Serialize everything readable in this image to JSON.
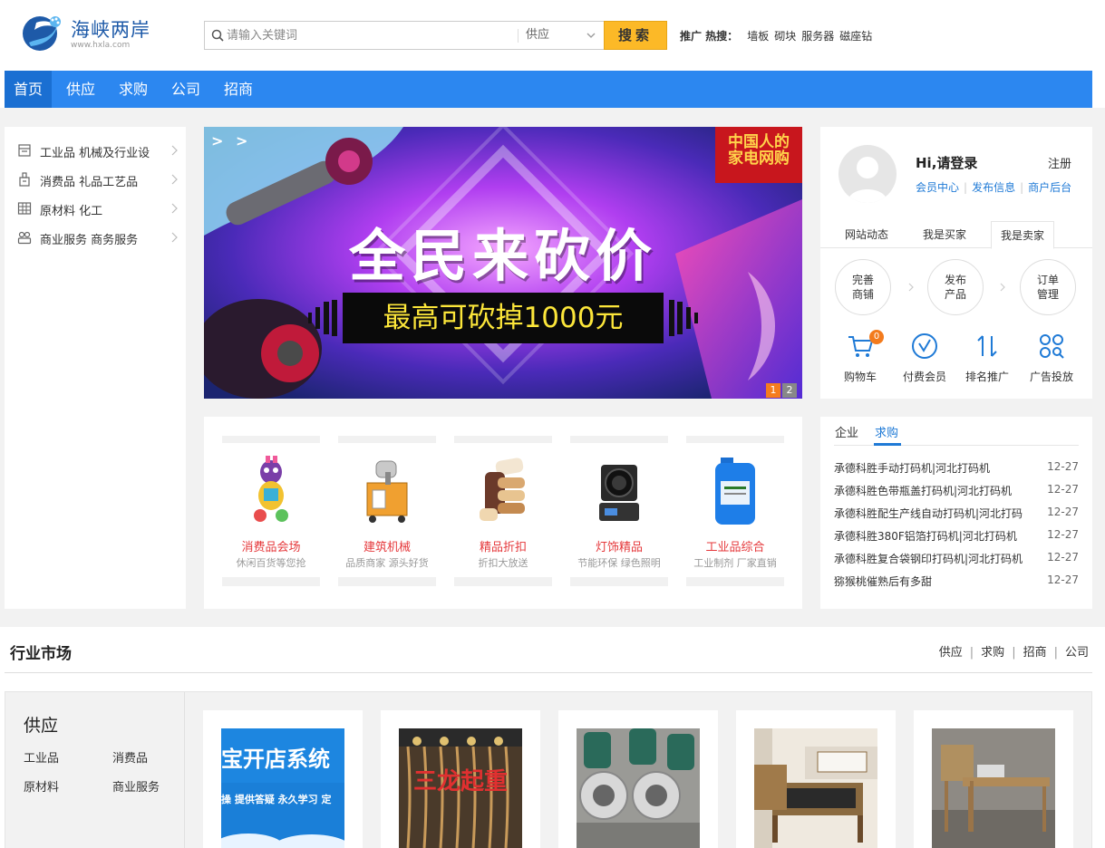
{
  "logo": {
    "title": "海峡两岸",
    "sub": "www.hxla.com"
  },
  "search": {
    "placeholder": "请输入关键词",
    "category": "供应",
    "button": "搜索"
  },
  "hot": {
    "label": "推广 热搜：",
    "items": [
      "墙板",
      "砌块",
      "服务器",
      "磁座钻"
    ]
  },
  "nav": [
    "首页",
    "供应",
    "求购",
    "公司",
    "招商"
  ],
  "categories": [
    {
      "label": "工业品 机械及行业设",
      "icon": "factory-icon"
    },
    {
      "label": "消费品 礼品工艺品",
      "icon": "bottle-icon"
    },
    {
      "label": "原材料 化工",
      "icon": "grid-icon"
    },
    {
      "label": "商业服务 商务服务",
      "icon": "people-icon"
    }
  ],
  "banner": {
    "arrows": "> >",
    "badge": "中国人的家电网购",
    "headline": "全民来砍价",
    "sub": "最高可砍掉1000元",
    "pages": [
      "1",
      "2"
    ],
    "colors": {
      "bg": "#3a1b6b",
      "accent": "#c8161d",
      "sub_text": "#fce63a"
    }
  },
  "features": [
    {
      "title": "消费品会场",
      "desc": "休闲百货等您抢"
    },
    {
      "title": "建筑机械",
      "desc": "品质商家 源头好货"
    },
    {
      "title": "精品折扣",
      "desc": "折扣大放送"
    },
    {
      "title": "灯饰精品",
      "desc": "节能环保 绿色照明"
    },
    {
      "title": "工业品综合",
      "desc": "工业制剂 厂家直销"
    }
  ],
  "user": {
    "greeting": "Hi,请登录",
    "register": "注册",
    "links": [
      "会员中心",
      "发布信息",
      "商户后台"
    ],
    "tabs": [
      "网站动态",
      "我是买家",
      "我是卖家"
    ],
    "steps": [
      {
        "line1": "完善",
        "line2": "商铺"
      },
      {
        "line1": "发布",
        "line2": "产品"
      },
      {
        "line1": "订单",
        "line2": "管理"
      }
    ],
    "quick": [
      {
        "label": "购物车",
        "icon": "cart-icon",
        "badge": "0"
      },
      {
        "label": "付费会员",
        "icon": "vip-icon"
      },
      {
        "label": "排名推广",
        "icon": "sort-icon"
      },
      {
        "label": "广告投放",
        "icon": "apps-icon"
      }
    ]
  },
  "news": {
    "tabs": [
      "企业",
      "求购"
    ],
    "items": [
      {
        "title": "承德科胜手动打码机|河北打码机",
        "date": "12-27"
      },
      {
        "title": "承德科胜色带瓶盖打码机|河北打码机",
        "date": "12-27"
      },
      {
        "title": "承德科胜配生产线自动打码机|河北打码",
        "date": "12-27"
      },
      {
        "title": "承德科胜380F铝箔打码机|河北打码机",
        "date": "12-27"
      },
      {
        "title": "承德科胜复合袋钢印打码机|河北打码机",
        "date": "12-27"
      },
      {
        "title": "猕猴桃催熟后有多甜",
        "date": "12-27"
      }
    ]
  },
  "market": {
    "title": "行业市场",
    "links": [
      "供应",
      "求购",
      "招商",
      "公司"
    ],
    "supply_title": "供应",
    "supply_links": [
      "工业品",
      "消费品",
      "原材料",
      "商业服务"
    ],
    "products": [
      {
        "overlay": "宝开店系统",
        "overlay2": "操 提供答疑 永久学习 定"
      },
      {
        "overlay": "三龙起重"
      },
      {
        "overlay": ""
      },
      {
        "overlay": ""
      },
      {
        "overlay": ""
      }
    ]
  },
  "colors": {
    "nav": "#2c87f0",
    "nav_active": "#1a6fd2",
    "search_btn": "#fcb927",
    "link": "#1f7ad6",
    "feature_title": "#e5383b"
  }
}
